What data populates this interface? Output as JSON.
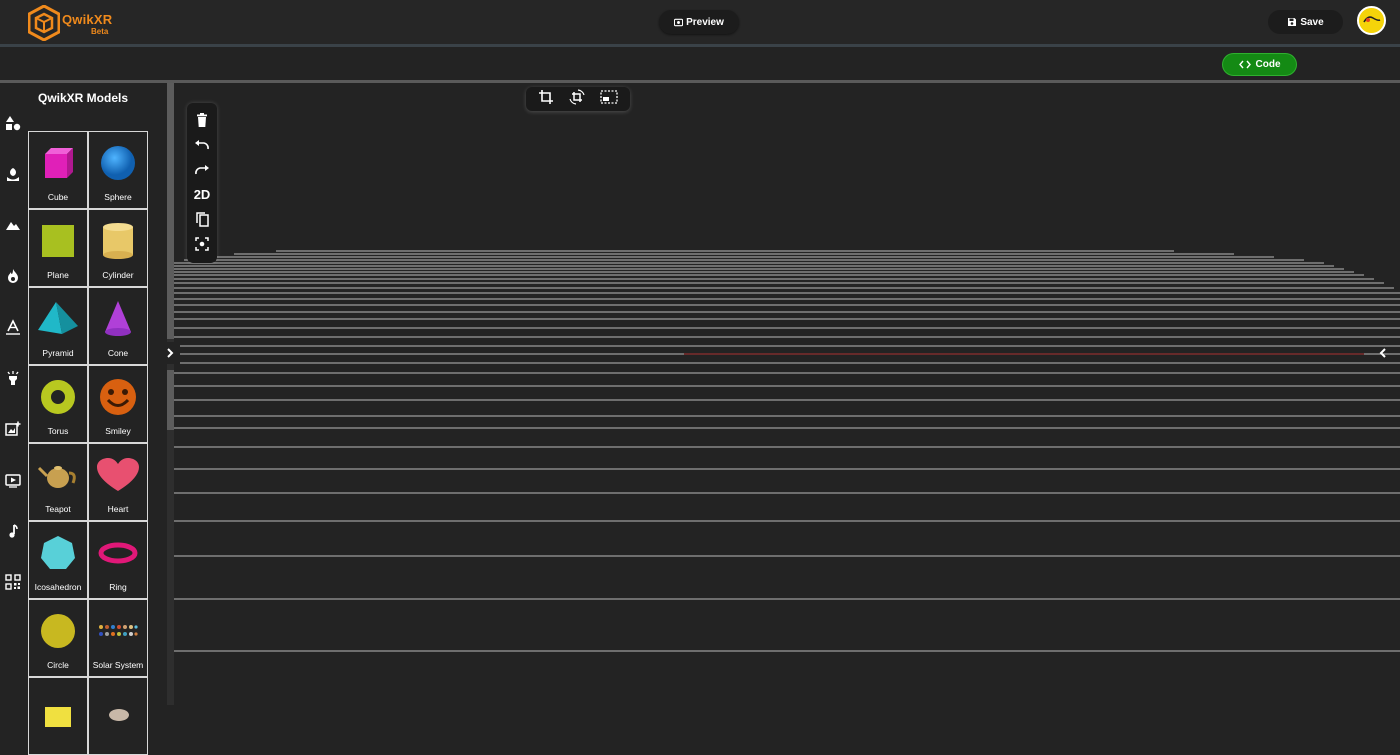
{
  "header": {
    "brand_name": "QwikXR",
    "brand_sub": "Beta",
    "preview_label": "Preview",
    "save_label": "Save",
    "code_label": "Code"
  },
  "sidebar": {
    "icons": [
      "shapes-icon",
      "nature-icon",
      "terrain-icon",
      "fire-icon",
      "text-icon",
      "light-icon",
      "add-image-icon",
      "video-icon",
      "music-icon",
      "qr-code-icon"
    ]
  },
  "models_panel": {
    "title": "QwikXR Models",
    "items": [
      {
        "label": "Cube",
        "icon": "cube-icon",
        "color": "#e020b8"
      },
      {
        "label": "Sphere",
        "icon": "sphere-icon",
        "color": "#1e88d8"
      },
      {
        "label": "Plane",
        "icon": "plane-icon",
        "color": "#a8c020"
      },
      {
        "label": "Cylinder",
        "icon": "cylinder-icon",
        "color": "#e8c868"
      },
      {
        "label": "Pyramid",
        "icon": "pyramid-icon",
        "color": "#20b8c8"
      },
      {
        "label": "Cone",
        "icon": "cone-icon",
        "color": "#b040d8"
      },
      {
        "label": "Torus",
        "icon": "torus-icon",
        "color": "#b8c820"
      },
      {
        "label": "Smiley",
        "icon": "smiley-icon",
        "color": "#d86010"
      },
      {
        "label": "Teapot",
        "icon": "teapot-icon",
        "color": "#c8a050"
      },
      {
        "label": "Heart",
        "icon": "heart-icon",
        "color": "#e85070"
      },
      {
        "label": "Icosahedron",
        "icon": "icosahedron-icon",
        "color": "#58d0d8"
      },
      {
        "label": "Ring",
        "icon": "ring-icon",
        "color": "#e01878"
      },
      {
        "label": "Circle",
        "icon": "circle-icon",
        "color": "#c8b820"
      },
      {
        "label": "Solar System",
        "icon": "solar-system-icon",
        "color": "#d09030"
      },
      {
        "label": "",
        "icon": "partial-icon",
        "color": "#f0e040"
      },
      {
        "label": "",
        "icon": "partial-icon",
        "color": "#c8b8a8"
      }
    ]
  },
  "edit_tools": {
    "items": [
      "delete-icon",
      "undo-icon",
      "redo-icon",
      "2d-toggle",
      "copy-icon",
      "focus-icon"
    ],
    "toggle_2d_label": "2D"
  },
  "view_tools": [
    "crop-icon",
    "crop-rotate-icon",
    "select-area-icon"
  ],
  "colors": {
    "brand": "#f08a1c",
    "code_button": "#148a14",
    "background": "#232323"
  }
}
